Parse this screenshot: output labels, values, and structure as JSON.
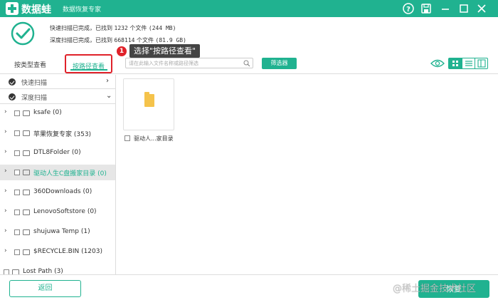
{
  "app": {
    "name": "数据蛙",
    "subtitle": "数据恢复专家"
  },
  "status": {
    "quick_prefix": "快速扫描已完成，已找到 ",
    "quick_count": "1232",
    "quick_mid": " 个文件 ",
    "quick_size": "(244 MB)",
    "deep_prefix": "深度扫描已完成，已找到 ",
    "deep_count": "668114",
    "deep_mid": " 个文件 ",
    "deep_size": "(81.9 GB)"
  },
  "tabs": {
    "by_type": "按类型查看",
    "by_path": "按路径查看"
  },
  "callout": {
    "number": "1",
    "text": "选择\"按路径查看\""
  },
  "search": {
    "placeholder": "请在此输入文件名称或路径筛选"
  },
  "filter_label": "筛选器",
  "scan_sections": [
    {
      "label": "快速扫描",
      "chevron": "›"
    },
    {
      "label": "深度扫描",
      "chevron": "⌄"
    }
  ],
  "tree": [
    {
      "name": "ksafe (0)",
      "arrow": "›"
    },
    {
      "name": "苹果恢复专家 (353)",
      "arrow": "›"
    },
    {
      "name": "DTL8Folder (0)",
      "arrow": "›"
    },
    {
      "name": "驱动人生C盘搬家目录 (0)",
      "arrow": "›"
    },
    {
      "name": "360Downloads (0)",
      "arrow": "›"
    },
    {
      "name": "LenovoSoftstore (0)",
      "arrow": "›"
    },
    {
      "name": "shujuwa Temp (1)",
      "arrow": "›"
    },
    {
      "name": "$RECYCLE.BIN (1203)",
      "arrow": "›"
    },
    {
      "name": "Lost Path (3)",
      "arrow": ""
    }
  ],
  "file": {
    "name": "驱动人...家目录"
  },
  "footer": {
    "back": "返回",
    "recover": "恢复"
  },
  "watermark": "@稀土掘金技术社区",
  "colors": {
    "brand": "#20b290",
    "highlight": "#e0222a"
  },
  "icons": [
    "help-icon",
    "save-icon",
    "minimize-icon",
    "maximize-icon",
    "close-icon",
    "check-circle-icon",
    "search-icon",
    "eye-icon",
    "grid-view-icon",
    "list-view-icon",
    "detail-view-icon",
    "folder-icon"
  ]
}
